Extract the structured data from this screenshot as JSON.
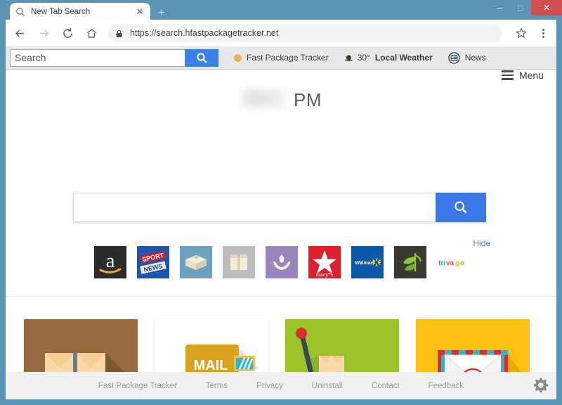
{
  "browser": {
    "tab": {
      "title": "New Tab Search",
      "favicon": "search-icon",
      "close": "✕"
    },
    "new_tab_label": "+",
    "window_controls": {
      "minimize": "–",
      "maximize": "□",
      "close": "✕"
    },
    "nav": {
      "back": "←",
      "forward": "→",
      "reload": "C",
      "home": "home-icon"
    },
    "url": "https://search.hfastpackagetracker.net",
    "lock": "lock-icon",
    "bookmark": "star-icon",
    "menu": "kebab-icon"
  },
  "ext_toolbar": {
    "search_placeholder": "Search",
    "search_value": "",
    "search_button": "search-icon",
    "links": [
      {
        "label": "Fast Package Tracker",
        "icon": "orange-dot-icon",
        "bold": false
      },
      {
        "label": "Local Weather",
        "prefix": "30°",
        "icon": "weather-icon",
        "bold": true
      },
      {
        "label": "News",
        "icon": "news-icon",
        "bold": false
      }
    ]
  },
  "page": {
    "menu_label": "Menu",
    "menu_icon": "hamburger-icon",
    "clock": {
      "digits": "",
      "ampm": "PM",
      "redacted": true
    },
    "search": {
      "value": "",
      "placeholder": "",
      "button_icon": "search-icon"
    },
    "hide_label": "Hide",
    "tiles": [
      {
        "name": "amazon",
        "label": "a"
      },
      {
        "name": "sport-news",
        "label": "SPORT NEWS"
      },
      {
        "name": "open-box",
        "label": ""
      },
      {
        "name": "carton-box",
        "label": ""
      },
      {
        "name": "charity-hands",
        "label": ""
      },
      {
        "name": "macys",
        "label": "macy*s"
      },
      {
        "name": "walmart",
        "label": "Walmart"
      },
      {
        "name": "leaf",
        "label": ""
      },
      {
        "name": "trivago",
        "label": "trivago"
      }
    ],
    "cards": [
      {
        "name": "package-card",
        "bg": "#96693f"
      },
      {
        "name": "mail-card",
        "bg": "#ffffff",
        "text": "MAIL"
      },
      {
        "name": "barrier-card",
        "bg": "#9ac428"
      },
      {
        "name": "airmail-card",
        "bg": "#fbc011"
      }
    ],
    "footer_links": [
      "Fast Package Tracker",
      "Terms",
      "Privacy",
      "Uninstall",
      "Contact",
      "Feedback"
    ],
    "settings_icon": "gear-icon"
  },
  "colors": {
    "window_frame": "#5b94b5",
    "accent_blue": "#3b78e7",
    "toolbar_bg": "#e8e8e8",
    "close_red": "#d0504f",
    "link_gray": "#9b9b9b"
  }
}
